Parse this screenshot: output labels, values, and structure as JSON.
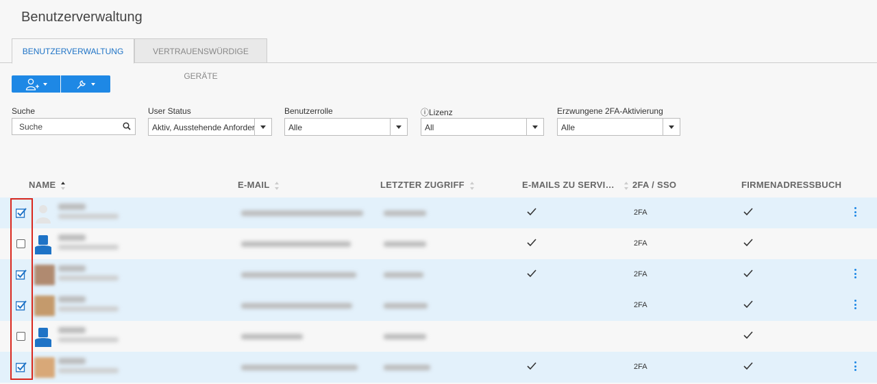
{
  "page": {
    "title": "Benutzerverwaltung"
  },
  "tabs": [
    {
      "label": "BENUTZERVERWALTUNG",
      "active": true
    },
    {
      "label": "VERTRAUENSWÜRDIGE GERÄTE",
      "active": false
    }
  ],
  "toolbar": {
    "add_user_icon": "add-user-icon",
    "tools_icon": "wrench-icon",
    "accent": "#1e88e5"
  },
  "filters": {
    "search": {
      "label": "Suche",
      "placeholder": "Suche"
    },
    "user_status": {
      "label": "User Status",
      "value": "Aktiv, Ausstehende Anforderu"
    },
    "role": {
      "label": "Benutzerrolle",
      "value": "Alle"
    },
    "license": {
      "label": "ⓘLizenz",
      "value": "All"
    },
    "tfa": {
      "label": "Erzwungene 2FA-Aktivierung",
      "value": "Alle"
    }
  },
  "table": {
    "columns": [
      "NAME",
      "E-MAIL",
      "LETZTER ZUGRIFF",
      "E-MAILS ZU SERVI…",
      "2FA / SSO",
      "FIRMENADRESSBUCH"
    ],
    "rows": [
      {
        "selected": true,
        "email_check": true,
        "tfa": "2FA",
        "addressbook": true,
        "menu": true
      },
      {
        "selected": false,
        "email_check": true,
        "tfa": "2FA",
        "addressbook": true,
        "menu": false
      },
      {
        "selected": true,
        "email_check": true,
        "tfa": "2FA",
        "addressbook": true,
        "menu": true
      },
      {
        "selected": true,
        "email_check": false,
        "tfa": "2FA",
        "addressbook": true,
        "menu": true
      },
      {
        "selected": false,
        "email_check": false,
        "tfa": "",
        "addressbook": true,
        "menu": false
      },
      {
        "selected": true,
        "email_check": true,
        "tfa": "2FA",
        "addressbook": true,
        "menu": true
      }
    ]
  },
  "colors": {
    "selected_row": "#e3f1fb",
    "highlight": "#d9261c",
    "link": "#1e73c6"
  }
}
